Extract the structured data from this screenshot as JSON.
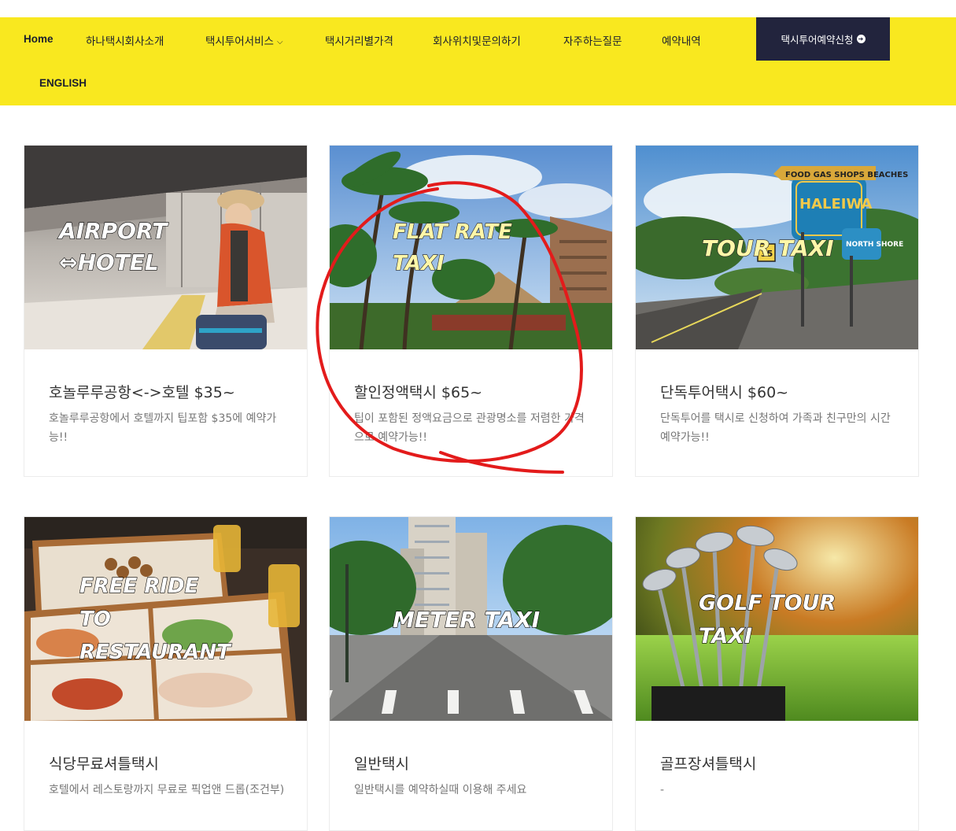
{
  "nav": {
    "home": "Home",
    "about": "하나택시회사소개",
    "tours": "택시투어서비스",
    "prices": "택시거리별가격",
    "location": "회사위치및문의하기",
    "faq": "자주하는질문",
    "reservations": "예약내역",
    "english": "ENGLISH",
    "cta": "택시투어예약신청"
  },
  "colors": {
    "nav_bg": "#f9e81f",
    "cta_bg": "#22243d",
    "annotation": "#e31b1b"
  },
  "cards": [
    {
      "image_text": [
        "AIRPORT",
        "⇔HOTEL"
      ],
      "title": "호놀루루공항<->호텔 $35~",
      "desc": "호놀루루공항에서 호텔까지 팁포함 $35에 예약가능!!"
    },
    {
      "image_text": [
        "FLAT RATE",
        "TAXI"
      ],
      "title": "할인정액택시 $65~",
      "desc": "팁이 포함된 정액요금으로 관광명소를 저렴한 가격으로 예약가능!!"
    },
    {
      "image_text": [
        "TOUR TAXI"
      ],
      "image_sign": [
        "FOOD GAS SHOPS BEACHES",
        "HALEIWA",
        "NORTH SHORE",
        "35"
      ],
      "title": "단독투어택시 $60~",
      "desc": "단독투어를 택시로 신청하여 가족과 친구만의 시간 예약가능!!"
    },
    {
      "image_text": [
        "FREE RIDE",
        "TO",
        "RESTAURANT"
      ],
      "title": "식당무료셔틀택시",
      "desc": "호텔에서 레스토랑까지 무료로 픽업앤 드롭(조건부)"
    },
    {
      "image_text": [
        "METER TAXI"
      ],
      "title": "일반택시",
      "desc": "일반택시를 예약하실때 이용해 주세요"
    },
    {
      "image_text": [
        "GOLF TOUR",
        "TAXI"
      ],
      "title": "골프장셔틀택시",
      "desc": "-"
    }
  ]
}
